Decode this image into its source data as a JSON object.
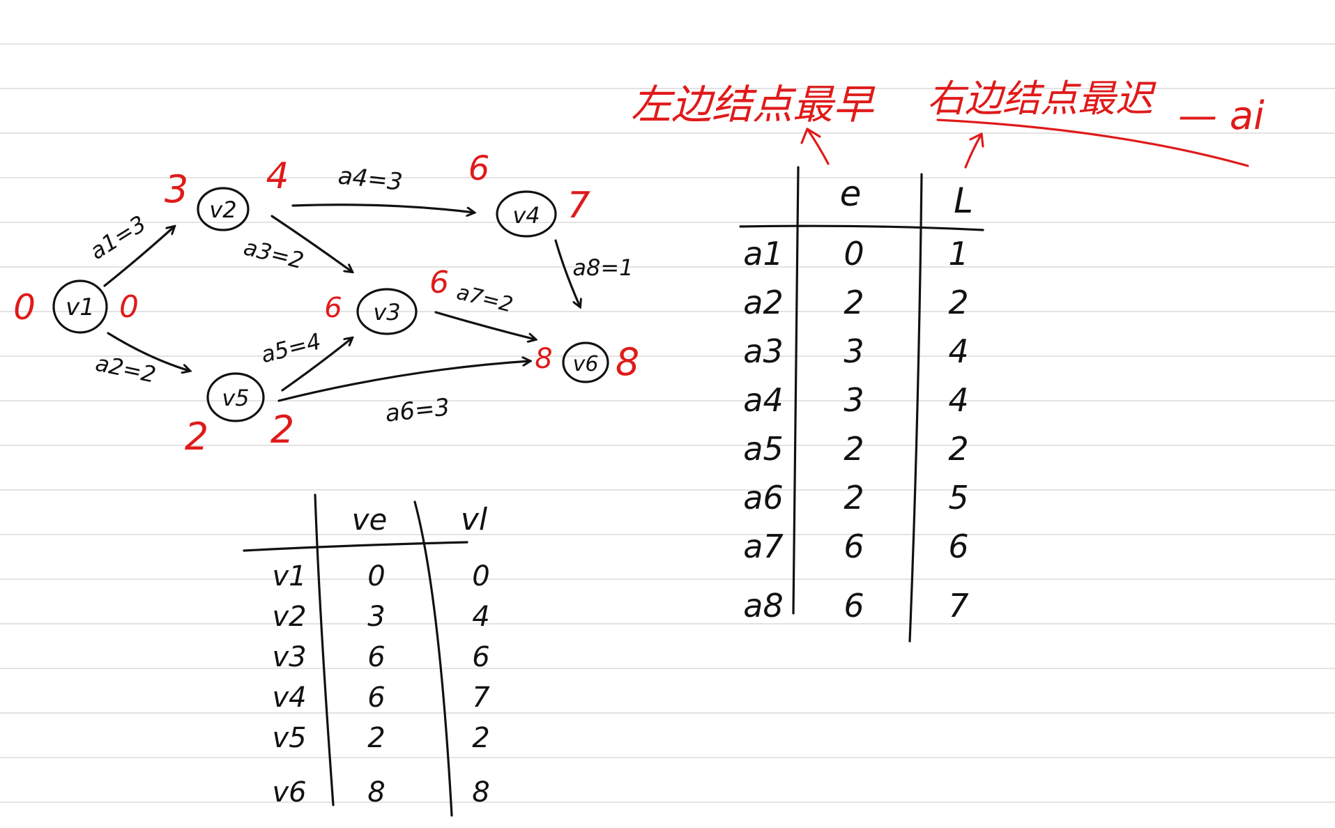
{
  "graph": {
    "nodes": [
      {
        "id": "v1",
        "label": "v1",
        "ve": "0",
        "vl": "0"
      },
      {
        "id": "v2",
        "label": "v2",
        "ve": "3",
        "vl": "4"
      },
      {
        "id": "v3",
        "label": "v3",
        "ve": "6",
        "vl": "6"
      },
      {
        "id": "v4",
        "label": "v4",
        "ve": "6",
        "vl": "7"
      },
      {
        "id": "v5",
        "label": "v5",
        "ve": "2",
        "vl": "2"
      },
      {
        "id": "v6",
        "label": "v6",
        "ve": "8",
        "vl": "8"
      }
    ],
    "edges": [
      {
        "label": "a1=3",
        "from": "v1",
        "to": "v2"
      },
      {
        "label": "a2=2",
        "from": "v1",
        "to": "v5"
      },
      {
        "label": "a3=2",
        "from": "v2",
        "to": "v3"
      },
      {
        "label": "a4=3",
        "from": "v2",
        "to": "v4"
      },
      {
        "label": "a5=4",
        "from": "v5",
        "to": "v3"
      },
      {
        "label": "a6=3",
        "from": "v5",
        "to": "v6"
      },
      {
        "label": "a7=2",
        "from": "v3",
        "to": "v6"
      },
      {
        "label": "a8=1",
        "from": "v4",
        "to": "v6"
      }
    ]
  },
  "vertex_table": {
    "headers": [
      "ve",
      "vl"
    ],
    "rows": [
      {
        "name": "v1",
        "ve": "0",
        "vl": "0"
      },
      {
        "name": "v2",
        "ve": "3",
        "vl": "4"
      },
      {
        "name": "v3",
        "ve": "6",
        "vl": "6"
      },
      {
        "name": "v4",
        "ve": "6",
        "vl": "7"
      },
      {
        "name": "v5",
        "ve": "2",
        "vl": "2"
      },
      {
        "name": "v6",
        "ve": "8",
        "vl": "8"
      }
    ]
  },
  "activity_table": {
    "headers": [
      "e",
      "L"
    ],
    "rows": [
      {
        "name": "a1",
        "e": "0",
        "l": "1"
      },
      {
        "name": "a2",
        "e": "2",
        "l": "2"
      },
      {
        "name": "a3",
        "e": "3",
        "l": "4"
      },
      {
        "name": "a4",
        "e": "3",
        "l": "4"
      },
      {
        "name": "a5",
        "e": "2",
        "l": "2"
      },
      {
        "name": "a6",
        "e": "2",
        "l": "5"
      },
      {
        "name": "a7",
        "e": "6",
        "l": "6"
      },
      {
        "name": "a8",
        "e": "6",
        "l": "7"
      }
    ]
  },
  "annotations": {
    "e_note": "左边结点最早",
    "l_note": "右边结点最迟",
    "l_suffix": "— ai"
  },
  "colors": {
    "ink": "#111111",
    "red": "#e01a1a",
    "rule": "#e3e3e3"
  }
}
